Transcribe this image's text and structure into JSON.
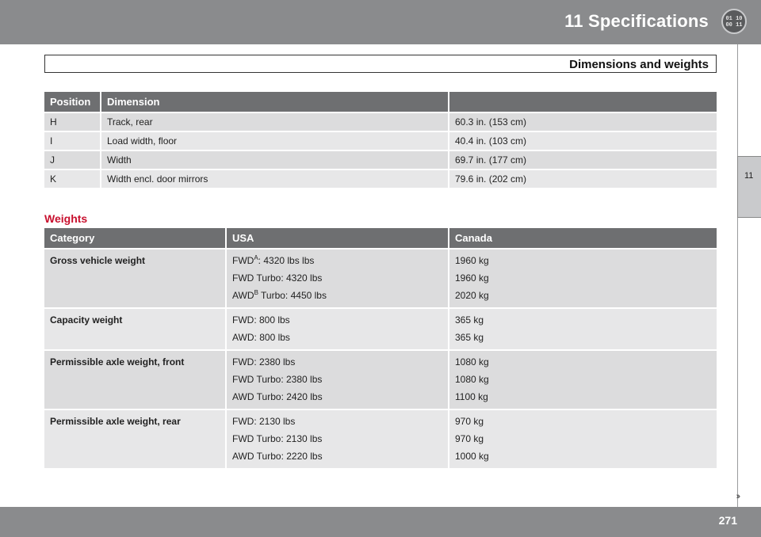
{
  "header": {
    "chapter_title": "11 Specifications",
    "badge_icon": "chapter-badge-icon",
    "badge_text_top": "01 10",
    "badge_text_bottom": "00 11"
  },
  "section": {
    "title": "Dimensions and weights"
  },
  "side_tab": {
    "number": "11"
  },
  "dimensions_table": {
    "headers": [
      "Position",
      "Dimension",
      ""
    ],
    "rows": [
      {
        "position": "H",
        "dimension": "Track, rear",
        "value": "60.3 in. (153 cm)"
      },
      {
        "position": "I",
        "dimension": "Load width, floor",
        "value": "40.4 in. (103 cm)"
      },
      {
        "position": "J",
        "dimension": "Width",
        "value": "69.7 in. (177 cm)"
      },
      {
        "position": "K",
        "dimension": "Width encl. door mirrors",
        "value": "79.6 in. (202 cm)"
      }
    ]
  },
  "weights": {
    "title": "Weights",
    "headers": [
      "Category",
      "USA",
      "Canada"
    ],
    "rows": [
      {
        "category": "Gross vehicle weight",
        "usa": [
          {
            "prefix": "FWD",
            "sup": "A",
            "suffix": ": 4320 lbs lbs"
          },
          {
            "prefix": "FWD Turbo: 4320 lbs",
            "sup": "",
            "suffix": ""
          },
          {
            "prefix": "AWD",
            "sup": "B",
            "suffix": " Turbo: 4450 lbs"
          }
        ],
        "canada": [
          "1960 kg",
          "1960 kg",
          "2020 kg"
        ]
      },
      {
        "category": "Capacity weight",
        "usa": [
          {
            "prefix": "FWD: 800 lbs",
            "sup": "",
            "suffix": ""
          },
          {
            "prefix": "AWD: 800 lbs",
            "sup": "",
            "suffix": ""
          }
        ],
        "canada": [
          "365 kg",
          "365 kg"
        ]
      },
      {
        "category": "Permissible axle weight, front",
        "usa": [
          {
            "prefix": "FWD: 2380 lbs",
            "sup": "",
            "suffix": ""
          },
          {
            "prefix": "FWD Turbo: 2380 lbs",
            "sup": "",
            "suffix": ""
          },
          {
            "prefix": "AWD Turbo: 2420 lbs",
            "sup": "",
            "suffix": ""
          }
        ],
        "canada": [
          "1080 kg",
          "1080 kg",
          "1100 kg"
        ]
      },
      {
        "category": "Permissible axle weight, rear",
        "usa": [
          {
            "prefix": "FWD: 2130 lbs",
            "sup": "",
            "suffix": ""
          },
          {
            "prefix": "FWD Turbo: 2130 lbs",
            "sup": "",
            "suffix": ""
          },
          {
            "prefix": "AWD Turbo: 2220 lbs",
            "sup": "",
            "suffix": ""
          }
        ],
        "canada": [
          "970 kg",
          "970 kg",
          "1000 kg"
        ]
      }
    ]
  },
  "footer": {
    "page_number": "271",
    "next_page_arrow": "››"
  },
  "colors": {
    "header_gray": "#8a8b8d",
    "table_header": "#6e6f71",
    "row_dark": "#dcdcdd",
    "row_light": "#e7e7e8",
    "accent_red": "#c8102e"
  }
}
